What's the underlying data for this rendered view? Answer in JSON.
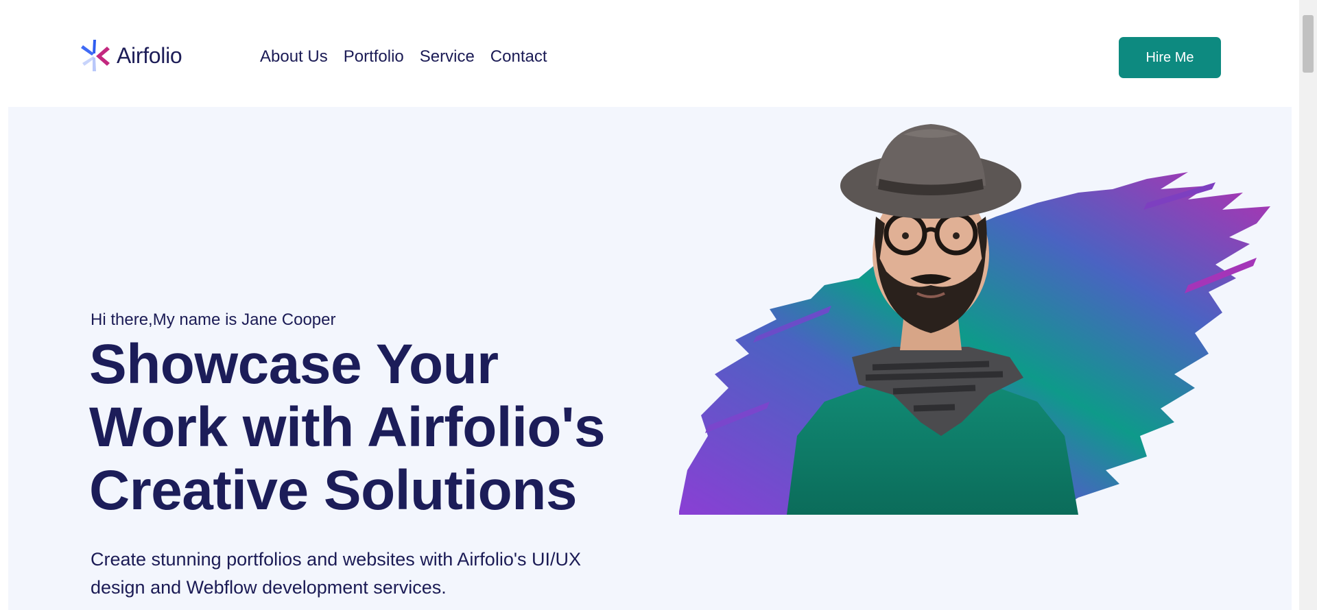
{
  "header": {
    "logo_text": "Airfolio",
    "logo_icon": "asterisk-logo-icon",
    "nav": [
      {
        "label": "About Us"
      },
      {
        "label": "Portfolio"
      },
      {
        "label": "Service"
      },
      {
        "label": "Contact"
      }
    ],
    "cta_label": "Hire Me"
  },
  "hero": {
    "greeting": "Hi there,My name is Jane Cooper",
    "headline": "Showcase Your Work with Airfolio's Creative Solutions",
    "subtext": "Create stunning portfolios and websites with Airfolio's UI/UX design and Webflow development services.",
    "image": "portrait-man-hat-glasses-scarf-icon"
  },
  "colors": {
    "brand_dark": "#1c1d59",
    "accent_teal": "#0d8a80",
    "hero_bg": "#f3f6fd",
    "brush_purple": "#8a3fd4",
    "brush_teal": "#0e9a8a",
    "brush_magenta": "#b52fb0"
  }
}
